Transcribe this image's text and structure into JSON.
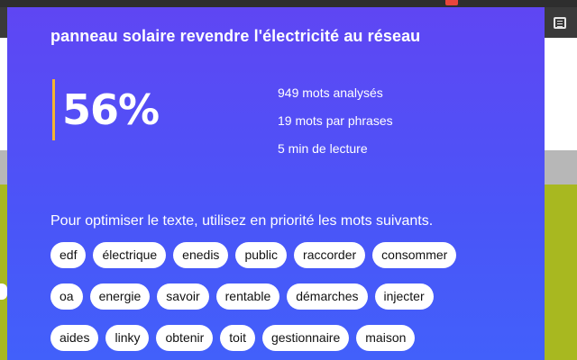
{
  "popup": {
    "title": "panneau solaire revendre l'électricité au réseau",
    "score": "56%",
    "stats": [
      "949 mots analysés",
      "19 mots par phrases",
      "5 min de lecture"
    ],
    "advice": "Pour optimiser le texte, utilisez en priorité les mots suivants.",
    "keywords": [
      [
        "edf",
        "électrique",
        "enedis",
        "public",
        "raccorder",
        "consommer"
      ],
      [
        "oa",
        "energie",
        "savoir",
        "rentable",
        "démarches",
        "injecter"
      ],
      [
        "aides",
        "linky",
        "obtenir",
        "toit",
        "gestionnaire",
        "maison"
      ]
    ]
  },
  "browser": {
    "extension_icon": "list-icon"
  },
  "colors": {
    "popup_gradient_top": "#5f46f3",
    "popup_gradient_bottom": "#4260fa",
    "score_accent": "#f2b431"
  }
}
